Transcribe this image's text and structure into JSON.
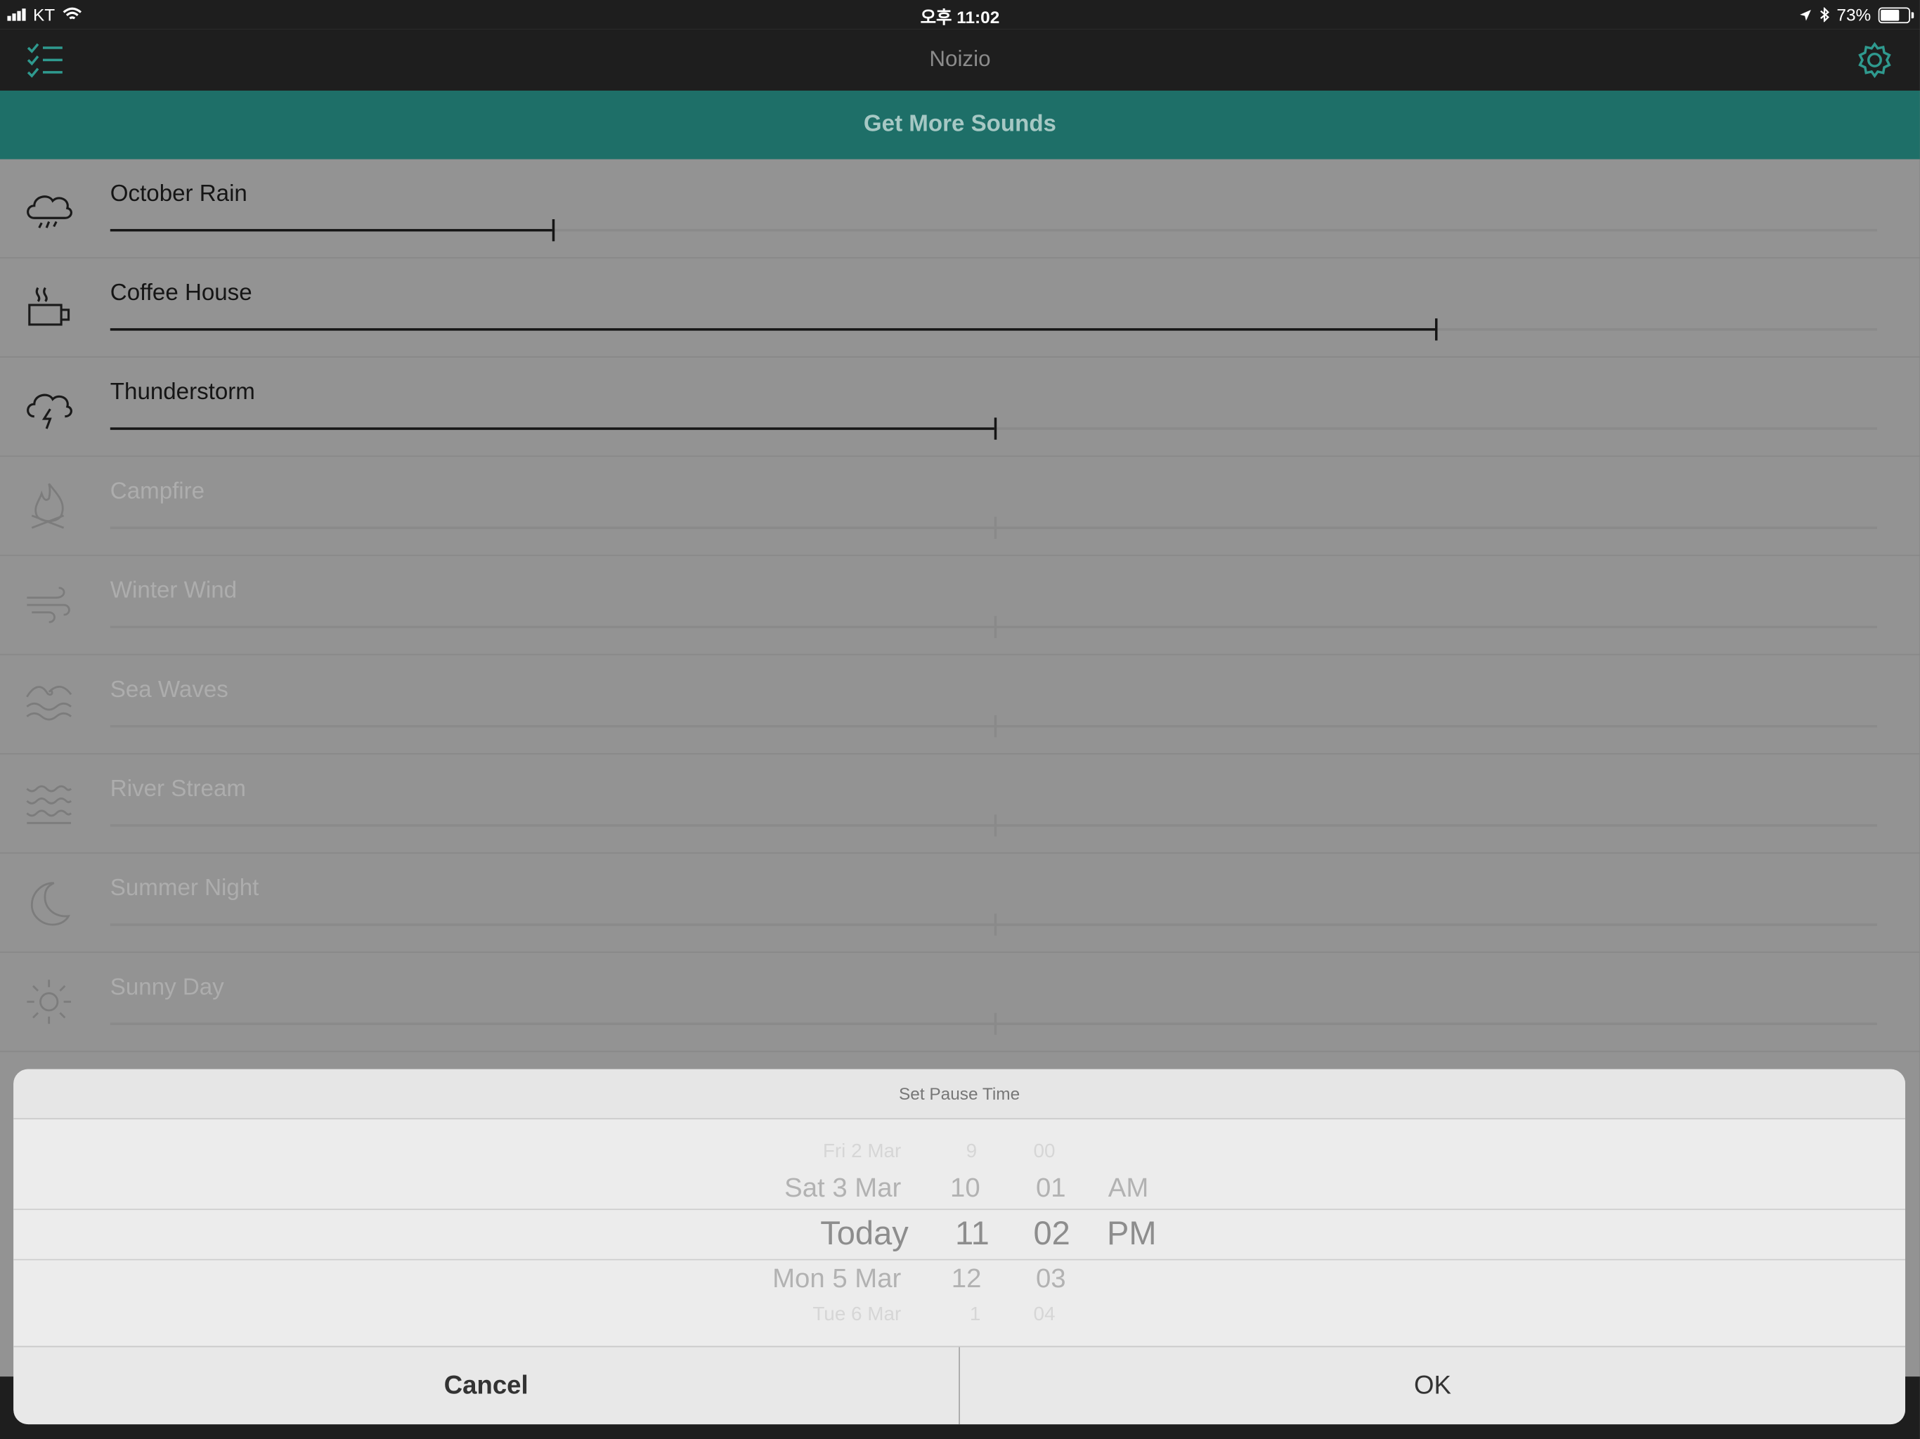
{
  "status_bar": {
    "carrier": "KT",
    "time": "오후 11:02",
    "battery": "73%",
    "battery_level": 0.73,
    "icons": [
      "signal-icon",
      "wifi-icon",
      "location-icon",
      "bluetooth-icon",
      "battery-icon"
    ]
  },
  "nav": {
    "title": "Noizio",
    "left_icon": "checklist-icon",
    "right_icon": "gear-icon"
  },
  "banner": {
    "label": "Get More Sounds"
  },
  "colors": {
    "accent": "#1e6f68",
    "banner_text": "#a6c8c4",
    "dark_bar": "#1e1e1e"
  },
  "sounds": [
    {
      "name": "October Rain",
      "icon": "rain-cloud-icon",
      "active": true,
      "volume": 0.25
    },
    {
      "name": "Coffee House",
      "icon": "coffee-cup-icon",
      "active": true,
      "volume": 0.75
    },
    {
      "name": "Thunderstorm",
      "icon": "thunder-cloud-icon",
      "active": true,
      "volume": 0.5
    },
    {
      "name": "Campfire",
      "icon": "campfire-icon",
      "active": false,
      "volume": 0.5
    },
    {
      "name": "Winter Wind",
      "icon": "wind-icon",
      "active": false,
      "volume": 0.5
    },
    {
      "name": "Sea Waves",
      "icon": "sea-waves-icon",
      "active": false,
      "volume": 0.5
    },
    {
      "name": "River Stream",
      "icon": "river-stream-icon",
      "active": false,
      "volume": 0.5
    },
    {
      "name": "Summer Night",
      "icon": "moon-icon",
      "active": false,
      "volume": 0.5
    },
    {
      "name": "Sunny Day",
      "icon": "sun-icon",
      "active": false,
      "volume": 0.5
    }
  ],
  "pause_sheet": {
    "title": "Set Pause Time",
    "date_column": [
      "Fri 2 Mar",
      "Sat 3 Mar",
      "Today",
      "Mon 5 Mar",
      "Tue 6 Mar"
    ],
    "hour_column": [
      "9",
      "10",
      "11",
      "12",
      "1"
    ],
    "minute_column": [
      "00",
      "01",
      "02",
      "03",
      "04"
    ],
    "ampm_column": [
      "AM",
      "PM"
    ],
    "selected": {
      "date": "Today",
      "hour": "11",
      "minute": "02",
      "ampm": "PM"
    },
    "cancel_label": "Cancel",
    "ok_label": "OK"
  }
}
